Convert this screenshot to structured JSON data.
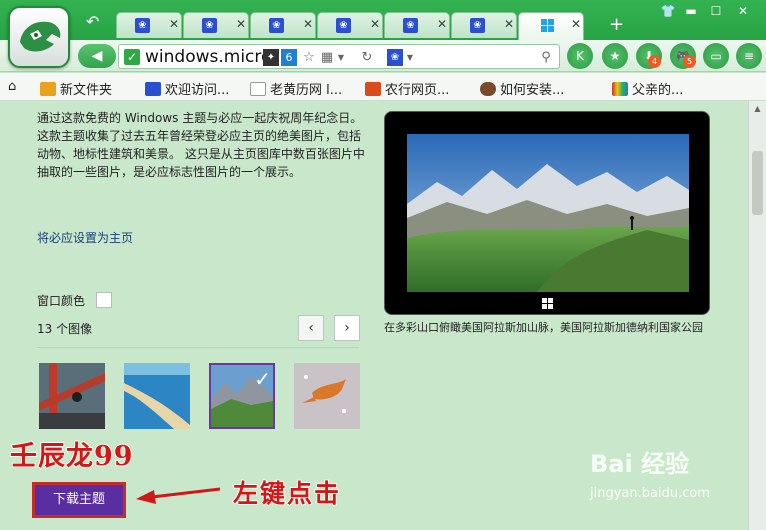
{
  "browser": {
    "tabs": [
      {
        "favicon": "paw-icon",
        "active": false
      },
      {
        "favicon": "paw-icon",
        "active": false
      },
      {
        "favicon": "paw-icon",
        "active": false
      },
      {
        "favicon": "paw-icon",
        "active": false
      },
      {
        "favicon": "paw-icon",
        "active": false
      },
      {
        "favicon": "paw-icon",
        "active": false
      },
      {
        "favicon": "windows-icon",
        "active": true
      }
    ],
    "address": "windows.micro",
    "nav_badges": {
      "download": "4",
      "game": "5"
    },
    "accent": "#2ea848"
  },
  "bookmarks": [
    {
      "label": "新文件夹",
      "icon": "folder-icon",
      "color": "#e9a21b"
    },
    {
      "label": "欢迎访问...",
      "icon": "paw-icon",
      "color": "#2a4fcf"
    },
    {
      "label": "老黄历网 l...",
      "icon": "document-icon",
      "color": "#999999"
    },
    {
      "label": "农行网页...",
      "icon": "bank-icon",
      "color": "#d94b1d"
    },
    {
      "label": "如何安装...",
      "icon": "avatar-icon",
      "color": "#7b4a2d"
    },
    {
      "label": "父亲的...",
      "icon": "flag-icon",
      "color": "#c0392b"
    }
  ],
  "content": {
    "description": "通过这款免费的 Windows 主题与必应一起庆祝周年纪念日。这款主题收集了过去五年曾经荣登必应主页的绝美图片，包括动物、地标性建筑和美景。 这只是从主页图库中数百张图片中抽取的一些图片，是必应标志性图片的一个展示。",
    "set_home_link": "将必应设置为主页",
    "window_color_label": "窗口颜色",
    "image_count": "13 个图像",
    "prev_label": "‹",
    "next_label": "›",
    "caption": "在多彩山口俯瞰美国阿拉斯加山脉，美国阿拉斯加德纳利国家公园",
    "download_button": "下载主题",
    "thumb_selected_color": "#6a38a3"
  },
  "annotations": {
    "author_tag": "壬辰龙99",
    "hint": "左键点击",
    "color": "#d01818"
  },
  "watermark": {
    "brand": "Bai 经验",
    "sub": "jingyan.baidu.com"
  }
}
